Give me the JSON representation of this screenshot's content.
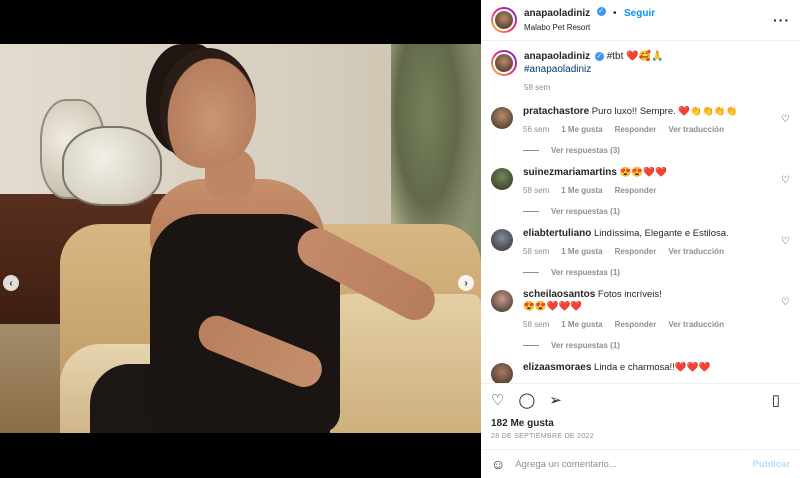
{
  "header": {
    "username": "anapaoladiniz",
    "separator": "•",
    "follow_label": "Seguir",
    "location": "Malabo Pet Resort",
    "more_label": "···"
  },
  "caption": {
    "username": "anapaoladiniz",
    "text": "#tbt ❤️🥰🙏",
    "hashtag": "#anapaoladiniz",
    "time": "58 sem"
  },
  "comments": [
    {
      "username": "pratachastore",
      "text": "Puro luxo!! Sempre. ❤️👏👏👏👏",
      "time": "56 sem",
      "likes": "1 Me gusta",
      "reply": "Responder",
      "translate": "Ver traducción",
      "replies": "Ver respuestas (3)",
      "avatar_color": "#b68d6a"
    },
    {
      "username": "suinezmariamartins",
      "text": "😍😍❤️❤️",
      "time": "58 sem",
      "likes": "1 Me gusta",
      "reply": "Responder",
      "translate": "",
      "replies": "Ver respuestas (1)",
      "avatar_color": "#6f8a5a"
    },
    {
      "username": "eliabtertuliano",
      "text": "Lindíssima, Elegante e Estilosa.",
      "time": "58 sem",
      "likes": "1 Me gusta",
      "reply": "Responder",
      "translate": "Ver traducción",
      "replies": "Ver respuestas (1)",
      "avatar_color": "#7c8ea3"
    },
    {
      "username": "scheilaosantos",
      "text": "Fotos incríveis!\n😍😍❤️❤️❤️",
      "time": "58 sem",
      "likes": "1 Me gusta",
      "reply": "Responder",
      "translate": "Ver traducción",
      "replies": "Ver respuestas (1)",
      "avatar_color": "#c79b8a"
    },
    {
      "username": "elizaasmoraes",
      "text": "Linda e charmosa!!❤️❤️❤️",
      "avatar_color": "#a87a62"
    }
  ],
  "actions": {
    "likes": "182 Me gusta",
    "date": "28 DE SEPTIEMBRE DE 2022"
  },
  "add_comment": {
    "placeholder": "Agrega un comentario...",
    "post_label": "Publicar"
  },
  "carousel": {
    "prev_icon": "chevron-left-icon",
    "next_icon": "chevron-right-icon",
    "dots": 10,
    "active_dot": 6
  }
}
